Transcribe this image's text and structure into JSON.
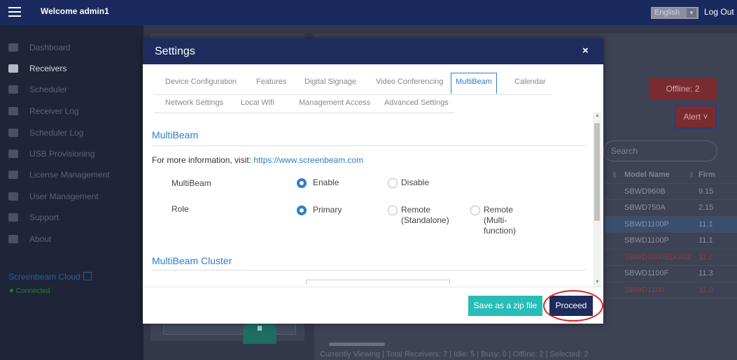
{
  "topbar": {
    "welcome": "Welcome admin1",
    "language": "English",
    "logout": "Log Out"
  },
  "sidebar": {
    "items": [
      {
        "label": "Dashboard",
        "icon": "dashboard-icon"
      },
      {
        "label": "Receivers",
        "icon": "monitor-icon",
        "active": true
      },
      {
        "label": "Scheduler",
        "icon": "calendar-icon"
      },
      {
        "label": "Receiver Log",
        "icon": "log-icon"
      },
      {
        "label": "Scheduler Log",
        "icon": "folder-icon"
      },
      {
        "label": "USB Provisioning",
        "icon": "usb-icon"
      },
      {
        "label": "License Management",
        "icon": "license-icon"
      },
      {
        "label": "User Management",
        "icon": "users-icon"
      },
      {
        "label": "Support",
        "icon": "info-icon"
      },
      {
        "label": "About",
        "icon": "question-icon"
      }
    ],
    "cloud": "Screenbeam Cloud",
    "connection": "Connected"
  },
  "background": {
    "offline": "Offline: 2",
    "alert": "Alert",
    "search_placeholder": "Search",
    "table": {
      "headers": [
        "Model Name",
        "Firm"
      ],
      "rows": [
        [
          "SBWD960B",
          "9.15"
        ],
        [
          "SBWD750A",
          "2.15"
        ],
        [
          "SBWD1100P",
          "11.1"
        ],
        [
          "SBWD1100P",
          "11.1"
        ],
        [
          "SBWD1000EDUG2",
          "11.2"
        ],
        [
          "SBWD1100F",
          "11.3"
        ],
        [
          "SBWD1100",
          "11.0"
        ]
      ]
    },
    "footer": "Currently Viewing | Total Receivers: 7 | Idle: 5 | Busy: 0 | Offline: 2 | Selected: 2"
  },
  "modal": {
    "title": "Settings",
    "close": "×",
    "tabs_row1": [
      "Device Configuration",
      "Features",
      "Digital Signage",
      "Video Conferencing",
      "MultiBeam",
      "Calendar"
    ],
    "tabs_row2": [
      "Network Settings",
      "Local Wifi",
      "Management Access",
      "Advanced Settings"
    ],
    "section_multibeam": "MultiBeam",
    "info_text": "For more information, visit: ",
    "info_link": "https://www.screenbeam.com",
    "multibeam_label": "MultiBeam",
    "multibeam_options": [
      "Enable",
      "Disable"
    ],
    "role_label": "Role",
    "role_option_1": "Primary",
    "role_option_2_line1": "Remote",
    "role_option_2_line2": "(Standalone)",
    "role_option_3_line1": "Remote",
    "role_option_3_line2": "(Multi-",
    "role_option_3_line3": "function)",
    "section_cluster": "MultiBeam Cluster",
    "save_zip": "Save as a zip file",
    "proceed": "Proceed"
  }
}
